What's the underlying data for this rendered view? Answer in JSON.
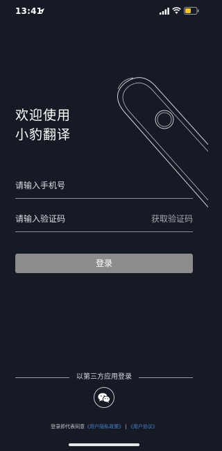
{
  "status_bar": {
    "time": "13:41"
  },
  "welcome": {
    "line1": "欢迎使用",
    "line2": "小豹翻译"
  },
  "form": {
    "phone_placeholder": "请输入手机号",
    "code_placeholder": "请输入验证码",
    "get_code_label": "获取验证码",
    "login_label": "登录"
  },
  "third_party": {
    "label": "以第三方应用登录",
    "icon": "wechat-icon"
  },
  "agreement": {
    "prefix": "登录即代表同意",
    "privacy_link": "《用户隐私政策》",
    "separator": " | ",
    "terms_link": "《用户协议》"
  },
  "colors": {
    "background": "#161a25",
    "login_button": "#8c8c8c",
    "link": "#4a7fd1",
    "battery": "#f2c230"
  }
}
